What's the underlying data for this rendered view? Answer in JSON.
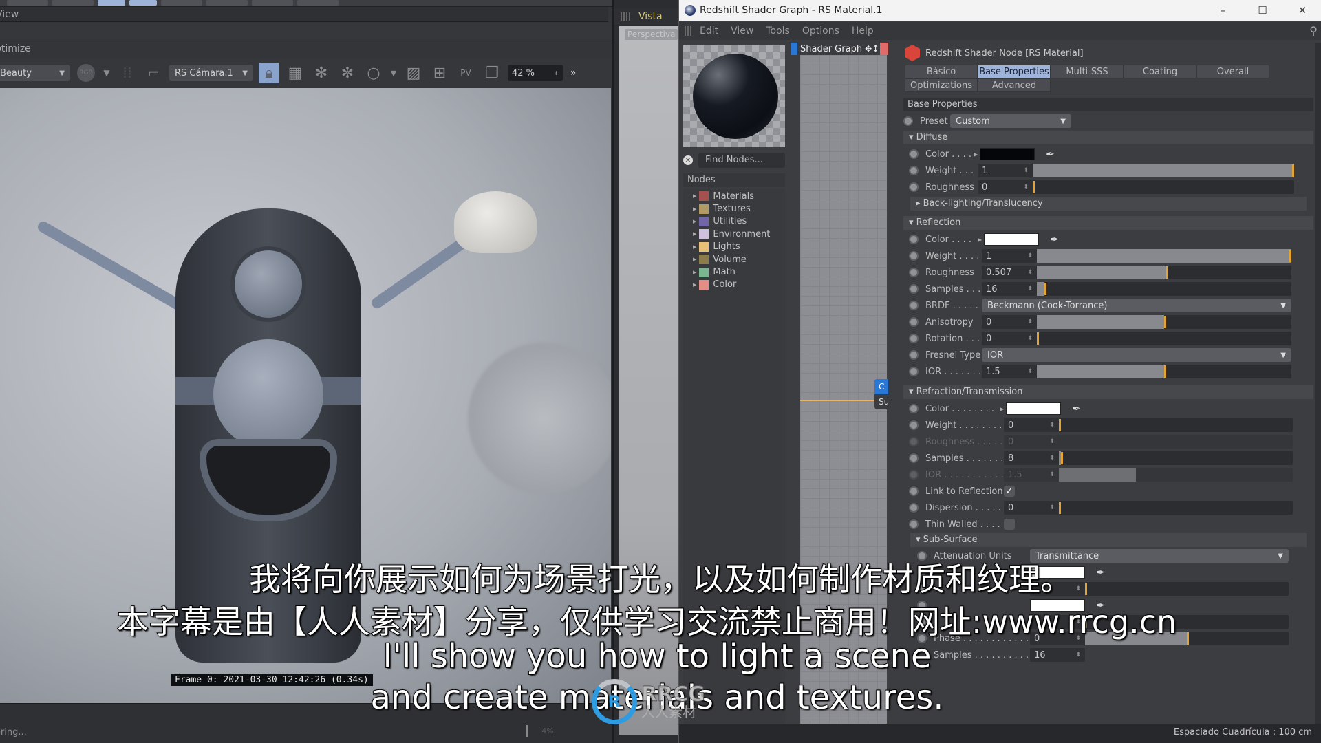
{
  "left_panel": {
    "menu_label": "View",
    "section_label": "Optimize",
    "toolbar": {
      "aov_select": "Beauty",
      "channel_label": "RGB",
      "camera_select": "RS Cámara.1",
      "zoom_value": "42 %",
      "icons": [
        "rgb-icon",
        "grid-dots-icon",
        "crop-icon",
        "lock-icon",
        "grid-icon",
        "snowflake-icon",
        "snowflake-g-icon",
        "circle-icon",
        "image-icon",
        "add-snapshot-icon",
        "pv-icon",
        "copy-icon",
        "more-icon"
      ]
    },
    "frame_info": "Frame  0:  2021-03-30  12:42:26  (0.34s)",
    "status_text": "Rendering...",
    "progress_text": "4%",
    "progress_value": 0.04
  },
  "viewport": {
    "menu_label": "Vista",
    "view_label": "Perspectiva"
  },
  "shader_window": {
    "title": "Redshift Shader Graph - RS Material.1",
    "window_controls": {
      "minimize": "–",
      "maximize": "☐",
      "close": "✕"
    },
    "menu": [
      "Edit",
      "View",
      "Tools",
      "Options",
      "Help"
    ],
    "find_placeholder": "Find Nodes...",
    "nodes_header": "Nodes",
    "node_categories": [
      {
        "label": "Materials",
        "color": "#a5524f"
      },
      {
        "label": "Textures",
        "color": "#b19a63"
      },
      {
        "label": "Utilities",
        "color": "#7266a6"
      },
      {
        "label": "Environment",
        "color": "#cfc0de"
      },
      {
        "label": "Lights",
        "color": "#e8c077"
      },
      {
        "label": "Volume",
        "color": "#8c7b4b"
      },
      {
        "label": "Math",
        "color": "#7ab68f"
      },
      {
        "label": "Color",
        "color": "#e28d86"
      }
    ],
    "graph_title": "Shader Graph",
    "graph_node": {
      "header": "C",
      "port": "Su"
    },
    "status_right": "Espaciado Cuadrícula : 100 cm"
  },
  "attributes": {
    "title": "Redshift Shader Node [RS Material]",
    "tabs_row1": [
      "Básico",
      "Base Properties",
      "Multi-SSS",
      "Coating",
      "Overall"
    ],
    "tabs_row2": [
      "Optimizations",
      "Advanced"
    ],
    "active_tab": "Base Properties",
    "section": "Base Properties",
    "preset_label": "Preset",
    "preset_value": "Custom",
    "diffuse": {
      "header": "Diffuse",
      "color_label": "Color . . . .",
      "color": "#05060a",
      "weight_label": "Weight . . .",
      "weight": "1",
      "weight_fraction": 1.0,
      "roughness_label": "Roughness",
      "roughness": "0",
      "roughness_fraction": 0.0,
      "backlighting": "Back-lighting/Translucency"
    },
    "reflection": {
      "header": "Reflection",
      "color_label": "Color . . . . .",
      "color": "#ffffff",
      "weight_label": "Weight . . . .",
      "weight": "1",
      "weight_fraction": 1.0,
      "roughness_label": "Roughness",
      "roughness": "0.507",
      "roughness_fraction": 0.507,
      "samples_label": "Samples . . .",
      "samples": "16",
      "samples_fraction": 0.03,
      "brdf_label": "BRDF . . . . . .",
      "brdf": "Beckmann (Cook-Torrance)",
      "anisotropy_label": "Anisotropy",
      "anisotropy": "0",
      "anisotropy_fraction": 0.5,
      "rotation_label": "Rotation . . .",
      "rotation": "0",
      "rotation_fraction": 0.0,
      "fresnel_label": "Fresnel Type",
      "fresnel": "IOR",
      "ior_label": "IOR . . . . . . .",
      "ior": "1.5",
      "ior_fraction": 0.5
    },
    "refraction": {
      "header": "Refraction/Transmission",
      "color_label": "Color . . . . . . . . .",
      "color": "#ffffff",
      "weight_label": "Weight . . . . . . . .",
      "weight": "0",
      "weight_fraction": 0.0,
      "roughness_label": "Roughness . . . . .",
      "roughness": "0",
      "samples_label": "Samples . . . . . . .",
      "samples": "8",
      "samples_fraction": 0.01,
      "ior_label": "IOR . . . . . . . . . . .",
      "ior": "1.5",
      "ior_fraction": 0.33,
      "link_label": "Link to Reflection",
      "link_checked": true,
      "dispersion_label": "Dispersion . . . . .",
      "dispersion": "0",
      "dispersion_fraction": 0.0,
      "thin_label": "Thin Walled . . . .",
      "thin_checked": false
    },
    "subsurface": {
      "header": "Sub-Surface",
      "attenuation_label": "Attenuation Units",
      "attenuation": "Transmittance",
      "phase_label": "Phase . . . . . . . . . . . .",
      "phase": "0",
      "phase_fraction": 0.5,
      "samples_label": "Samples . . . . . . . . . .",
      "samples": "16"
    }
  },
  "subtitles": {
    "zh_line1": "我将向你展示如何为场景打光，以及如何制作材质和纹理。",
    "zh_line2": "本字幕是由【人人素材】分享，仅供学习交流禁止商用！网址:www.rrcg.cn",
    "en_line1": "I'll show you how to light a scene",
    "en_line2": "and create materials and textures."
  },
  "watermark": {
    "brand": "RRCG",
    "brand_zh": "人人素材"
  }
}
